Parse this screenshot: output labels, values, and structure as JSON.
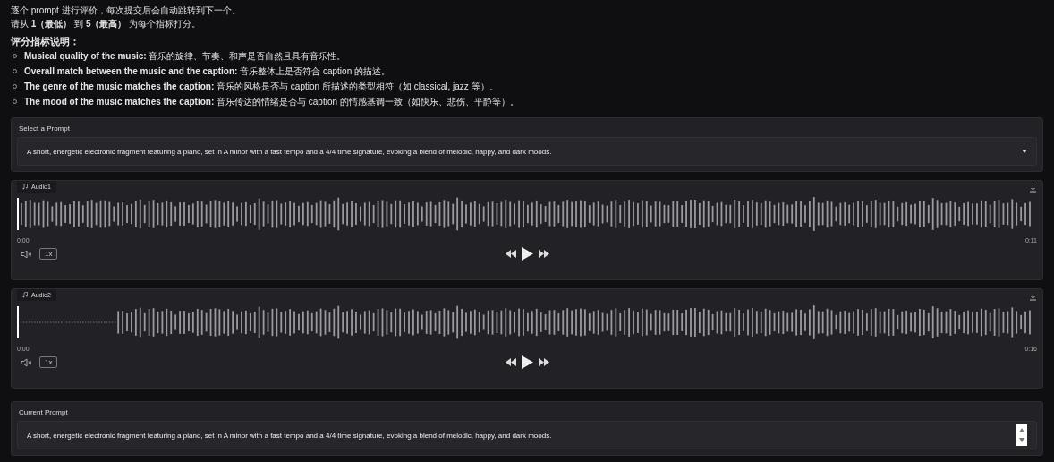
{
  "intro": [
    "逐个 prompt 进行评价，每次提交后会自动跳转到下一个。",
    "请从 **1（最低）** 到 **5（最高）** 为每个指标打分。"
  ],
  "criteria_title": "评分指标说明：",
  "criteria": [
    {
      "name": "Musical quality of the music:",
      "desc": "音乐的旋律、节奏、和声是否自然且具有音乐性。"
    },
    {
      "name": "Overall match between the music and the caption:",
      "desc": "音乐整体上是否符合 caption 的描述。"
    },
    {
      "name": "The genre of the music matches the caption:",
      "desc": "音乐的风格是否与 caption 所描述的类型相符（如 classical, jazz 等）。"
    },
    {
      "name": "The mood of the music matches the caption:",
      "desc": "音乐传达的情绪是否与 caption 的情感基调一致（如快乐、悲伤、平静等）。"
    }
  ],
  "select_prompt": {
    "label": "Select a Prompt",
    "value": "A short, energetic electronic fragment featuring a piano, set in A minor with a fast tempo and a 4/4 time signature, evoking a blend of melodic, happy, and dark moods."
  },
  "audios": [
    {
      "label": "Audio1",
      "leading_silence": false,
      "start": "0:00",
      "end": "0:11",
      "speed": "1x"
    },
    {
      "label": "Audio2",
      "leading_silence": true,
      "start": "0:00",
      "end": "0:16",
      "speed": "1x"
    }
  ],
  "current_prompt": {
    "label": "Current Prompt",
    "value": "A short, energetic electronic fragment featuring a piano, set in A minor with a fast tempo and a 4/4 time signature, evoking a blend of melodic, happy, and dark moods."
  }
}
